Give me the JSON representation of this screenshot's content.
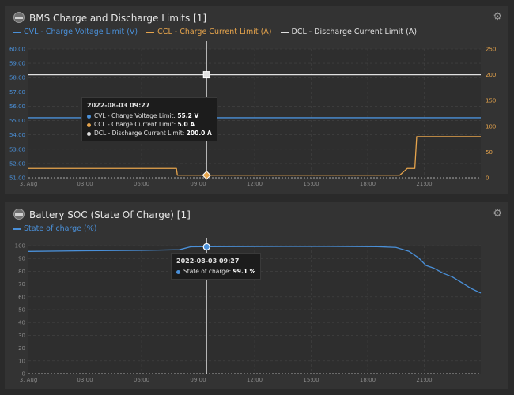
{
  "colors": {
    "cvl": "#4a90d9",
    "ccl": "#e6a44c",
    "dcl": "#e0e0e0",
    "soc": "#4a90d9"
  },
  "panel1": {
    "title": "BMS Charge and Discharge Limits [1]",
    "icon": "gear-icon",
    "legend": [
      {
        "label": "CVL - Charge Voltage Limit (V)",
        "color": "#4a90d9"
      },
      {
        "label": "CCL - Charge Current Limit (A)",
        "color": "#e6a44c"
      },
      {
        "label": "DCL - Discharge Current Limit (A)",
        "color": "#e0e0e0"
      }
    ],
    "tooltip": {
      "title": "2022-08-03 09:27",
      "rows": [
        {
          "label": "CVL - Charge Voltage Limit: ",
          "value": "55.2 V"
        },
        {
          "label": "CCL - Charge Current Limit: ",
          "value": "5.0 A"
        },
        {
          "label": "DCL - Discharge Current Limit: ",
          "value": "200.0 A"
        }
      ]
    }
  },
  "panel2": {
    "title": "Battery SOC (State Of Charge) [1]",
    "icon": "gear-icon",
    "legend": [
      {
        "label": "State of charge (%)",
        "color": "#4a90d9"
      }
    ],
    "tooltip": {
      "title": "2022-08-03 09:27",
      "rows": [
        {
          "label": "State of charge: ",
          "value": "99.1 %"
        }
      ]
    }
  },
  "chart_data": [
    {
      "type": "line",
      "title": "BMS Charge and Discharge Limits [1]",
      "xticks": [
        "3. Aug",
        "03:00",
        "06:00",
        "09:00",
        "12:00",
        "15:00",
        "18:00",
        "21:00"
      ],
      "xlim_hours": [
        0,
        24
      ],
      "ylim_left": [
        51,
        60
      ],
      "yticks_left": [
        "51.00",
        "52.00",
        "53.00",
        "54.00",
        "55.00",
        "56.00",
        "57.00",
        "58.00",
        "59.00",
        "60.00"
      ],
      "ylim_right": [
        0,
        250
      ],
      "yticks_right": [
        "0",
        "50",
        "100",
        "150",
        "200",
        "250"
      ],
      "crosshair_hour": 9.45,
      "series": [
        {
          "name": "CVL - Charge Voltage Limit (V)",
          "axis": "left",
          "color": "#4a90d9",
          "points": [
            [
              0,
              55.2
            ],
            [
              24,
              55.2
            ]
          ]
        },
        {
          "name": "CCL - Charge Current Limit (A)",
          "axis": "right",
          "color": "#e6a44c",
          "points": [
            [
              0,
              18
            ],
            [
              7.85,
              18
            ],
            [
              7.9,
              5
            ],
            [
              19.7,
              5
            ],
            [
              20.1,
              18
            ],
            [
              20.5,
              18
            ],
            [
              20.6,
              80
            ],
            [
              24,
              80
            ]
          ]
        },
        {
          "name": "DCL - Discharge Current Limit (A)",
          "axis": "right",
          "color": "#e0e0e0",
          "points": [
            [
              0,
              200
            ],
            [
              24,
              200
            ]
          ]
        }
      ],
      "markers": [
        {
          "axis": "left",
          "x": 9.45,
          "y": 55.2,
          "color": "#4a90d9",
          "shape": "circle"
        },
        {
          "axis": "right",
          "x": 9.45,
          "y": 5,
          "color": "#e6a44c",
          "shape": "diamond"
        },
        {
          "axis": "right",
          "x": 9.45,
          "y": 200,
          "color": "#e0e0e0",
          "shape": "square"
        }
      ]
    },
    {
      "type": "line",
      "title": "Battery SOC (State Of Charge) [1]",
      "xticks": [
        "3. Aug",
        "03:00",
        "06:00",
        "09:00",
        "12:00",
        "15:00",
        "18:00",
        "21:00"
      ],
      "xlim_hours": [
        0,
        24
      ],
      "ylim": [
        0,
        100
      ],
      "yticks": [
        "0",
        "10",
        "20",
        "30",
        "40",
        "50",
        "60",
        "70",
        "80",
        "90",
        "100"
      ],
      "crosshair_hour": 9.45,
      "series": [
        {
          "name": "State of charge (%)",
          "color": "#4a90d9",
          "points": [
            [
              0,
              95.5
            ],
            [
              3,
              96
            ],
            [
              6,
              96.3
            ],
            [
              8,
              96.8
            ],
            [
              8.6,
              99.1
            ],
            [
              12,
              99.3
            ],
            [
              13.5,
              99.4
            ],
            [
              16,
              99.4
            ],
            [
              18.5,
              99.2
            ],
            [
              19.5,
              98.6
            ],
            [
              20.2,
              95.5
            ],
            [
              20.7,
              90.5
            ],
            [
              21.1,
              84.5
            ],
            [
              21.5,
              82.5
            ],
            [
              22,
              78.5
            ],
            [
              22.5,
              75.5
            ],
            [
              23,
              71
            ],
            [
              23.5,
              66.5
            ],
            [
              24,
              63
            ]
          ]
        }
      ],
      "markers": [
        {
          "x": 9.45,
          "y": 99.1,
          "color": "#4a90d9",
          "shape": "circle"
        }
      ]
    }
  ]
}
